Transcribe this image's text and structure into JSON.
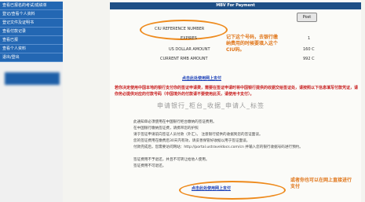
{
  "sidebar": {
    "items": [
      "查看已报名的考试/成绩单",
      "登记/查看个人资料",
      "登记文件及证明书",
      "查看付款记录",
      "查看已报",
      "查看个人资料",
      "退出/登出"
    ]
  },
  "header": {
    "title": "MBV For Payment"
  },
  "form": {
    "post_button": "Post",
    "rows": [
      {
        "label": "CIU REFERENCE NUMBER",
        "value": ""
      },
      {
        "label": "EXPIRES",
        "value": "1"
      },
      {
        "label": "US DOLLAR AMOUNT",
        "value": "160 C"
      },
      {
        "label": "CURRENT RMB AMOUNT",
        "value": "992 C"
      }
    ]
  },
  "annotations": {
    "top": "记下这个号码，去银行缴纳费用的时候要填入这个CIU码。",
    "bottom": "或者你也可以在网上直接进行支付"
  },
  "links": {
    "online_pay": "点击此处使用网上支付",
    "online_pay_bottom": "点击此处使用网上支付"
  },
  "notice": {
    "red_text": "若你决定使用中国本地的银行支付你的签证申请费，需要在签证申请时将中国银行提供的收据交给签证处，请按照以下信息填写付款凭证，请你务必提供对应的付款号码（中国境外的付款请不要使用此页，请使用卡支付）。",
    "stamp": "申请银行_柜台_收据_申请人_标签"
  },
  "body": {
    "lines": [
      "此通知单必须使用在中国银行柜台缴纳的签证费用。",
      "在中国银行缴纳签证费，请携带您的护照",
      "请于签证申请前向签证人员付款（外汇）。 注意银行提供的收据到您的签证面谈。",
      "您的签证费用在缴费后30天内有效，请妥善保管好收据以用于签证面谈。",
      "付款完成后，您需要访问网站：http://portal.ustraveldocs.com/cn 并输入您的银行收据号码进行预约。",
      "签证费用不予退还，并且不可转让给他人使用。",
      "签证费用不可退还。"
    ]
  }
}
